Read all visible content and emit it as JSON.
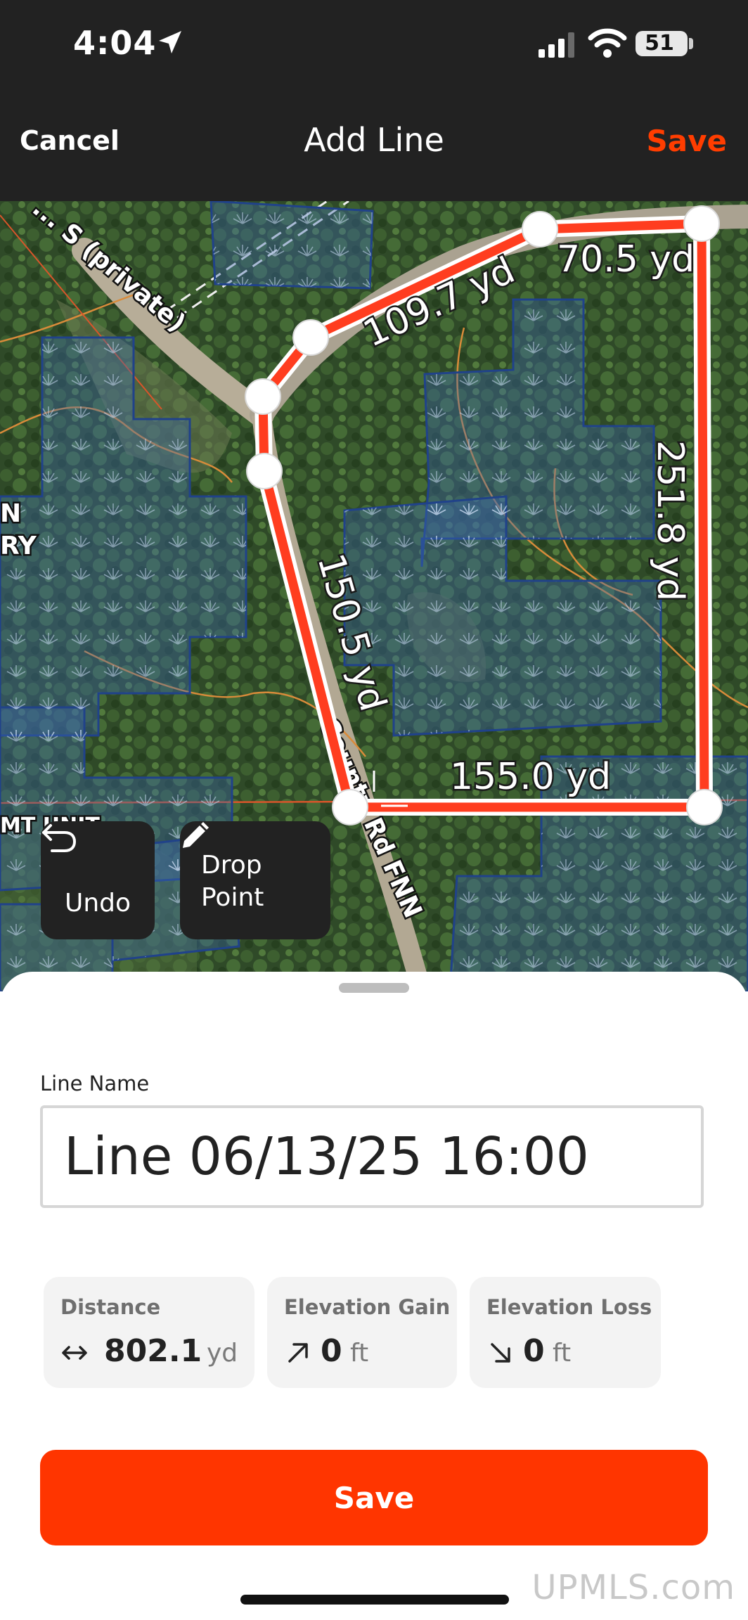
{
  "status_bar": {
    "time": "4:04",
    "battery": "51"
  },
  "nav": {
    "cancel": "Cancel",
    "title": "Add Line",
    "save": "Save"
  },
  "map": {
    "road_labels": [
      "... S (private)",
      "County Rd FNN"
    ],
    "edge_labels": [
      "N",
      "RY",
      "MT UNIT"
    ],
    "segments": [
      {
        "label": "109.7 yd"
      },
      {
        "label": "70.5 yd"
      },
      {
        "label": "251.8 yd"
      },
      {
        "label": "155.0 yd"
      },
      {
        "label": "150.5 yd"
      }
    ],
    "controls": {
      "undo": "Undo",
      "drop_line1": "Drop",
      "drop_line2": "Point"
    }
  },
  "form": {
    "name_label": "Line Name",
    "name_value": "Line 06/13/25 16:00",
    "stats": [
      {
        "title": "Distance",
        "icon": "double-arrow-icon",
        "value": "802.1",
        "unit": "yd"
      },
      {
        "title": "Elevation Gain",
        "icon": "arrow-up-right-icon",
        "value": "0",
        "unit": "ft"
      },
      {
        "title": "Elevation Loss",
        "icon": "arrow-down-right-icon",
        "value": "0",
        "unit": "ft"
      }
    ],
    "save_button": "Save"
  },
  "watermark": "UPMLS.com",
  "colors": {
    "accent": "#ff3500",
    "line": "#ff3d1f",
    "dark_bar": "#222222"
  }
}
